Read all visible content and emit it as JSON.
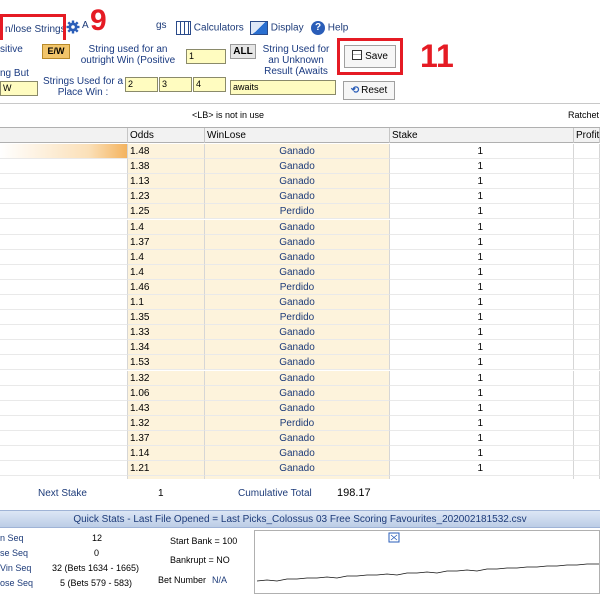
{
  "toolbar": {
    "winlose_tab": "n/lose Strings",
    "a_label": "A",
    "settings_fragment": "gs",
    "calculators": "Calculators",
    "display": "Display",
    "help": "Help",
    "callout_9": "9",
    "callout_11": "11"
  },
  "config": {
    "positive_label": "sitive",
    "ew_button": "E/W",
    "outright_label": "String used for an outright Win (Positive",
    "outright_value": "1",
    "all_button": "ALL",
    "unknown_label": "String Used for an Unknown Result (Awaits",
    "save_button": "Save",
    "ng_but_label": "ng But",
    "ng_but_value": "W",
    "place_label": "Strings Used for a Place Win :",
    "place_values": [
      "2",
      "3",
      "4"
    ],
    "awaits_value": "awaits",
    "reset_button": "Reset"
  },
  "info": {
    "lb_note": "<LB> is not in use",
    "ratchet": "Ratchet"
  },
  "grid": {
    "headers": [
      "",
      "Odds",
      "WinLose",
      "Stake",
      "Profit"
    ],
    "rows": [
      {
        "odds": "1.48",
        "winlose": "Ganado",
        "stake": "1"
      },
      {
        "odds": "1.38",
        "winlose": "Ganado",
        "stake": "1"
      },
      {
        "odds": "1.13",
        "winlose": "Ganado",
        "stake": "1"
      },
      {
        "odds": "1.23",
        "winlose": "Ganado",
        "stake": "1"
      },
      {
        "odds": "1.25",
        "winlose": "Perdido",
        "stake": "1"
      },
      {
        "odds": "1.4",
        "winlose": "Ganado",
        "stake": "1"
      },
      {
        "odds": "1.37",
        "winlose": "Ganado",
        "stake": "1"
      },
      {
        "odds": "1.4",
        "winlose": "Ganado",
        "stake": "1"
      },
      {
        "odds": "1.4",
        "winlose": "Ganado",
        "stake": "1"
      },
      {
        "odds": "1.46",
        "winlose": "Perdido",
        "stake": "1"
      },
      {
        "odds": "1.1",
        "winlose": "Ganado",
        "stake": "1"
      },
      {
        "odds": "1.35",
        "winlose": "Perdido",
        "stake": "1"
      },
      {
        "odds": "1.33",
        "winlose": "Ganado",
        "stake": "1"
      },
      {
        "odds": "1.34",
        "winlose": "Ganado",
        "stake": "1"
      },
      {
        "odds": "1.53",
        "winlose": "Ganado",
        "stake": "1"
      },
      {
        "odds": "1.32",
        "winlose": "Ganado",
        "stake": "1"
      },
      {
        "odds": "1.06",
        "winlose": "Ganado",
        "stake": "1"
      },
      {
        "odds": "1.43",
        "winlose": "Ganado",
        "stake": "1"
      },
      {
        "odds": "1.32",
        "winlose": "Perdido",
        "stake": "1"
      },
      {
        "odds": "1.37",
        "winlose": "Ganado",
        "stake": "1"
      },
      {
        "odds": "1.14",
        "winlose": "Ganado",
        "stake": "1"
      },
      {
        "odds": "1.21",
        "winlose": "Ganado",
        "stake": "1"
      },
      {
        "odds": "",
        "winlose": "",
        "stake": ""
      }
    ]
  },
  "totals": {
    "next_stake_label": "Next Stake",
    "next_stake_value": "1",
    "cumulative_label": "Cumulative Total",
    "cumulative_value": "198.17"
  },
  "quick_stats": {
    "title": "Quick Stats - Last File Opened = Last Picks_Colossus 03 Free Scoring Favourites_202002181532.csv",
    "win_seq_label": "n Seq",
    "win_seq_value": "12",
    "lose_seq_label": "se Seq",
    "lose_seq_value": "0",
    "max_win_label": "Vin Seq",
    "max_win_value": "32  (Bets 1634 - 1665)",
    "max_lose_label": "ose Seq",
    "max_lose_value": "5  (Bets 579 - 583)",
    "start_bank": "Start Bank = 100",
    "bankrupt": "Bankrupt = NO",
    "bet_number_label": "Bet Number",
    "bet_number_value": "N/A"
  }
}
